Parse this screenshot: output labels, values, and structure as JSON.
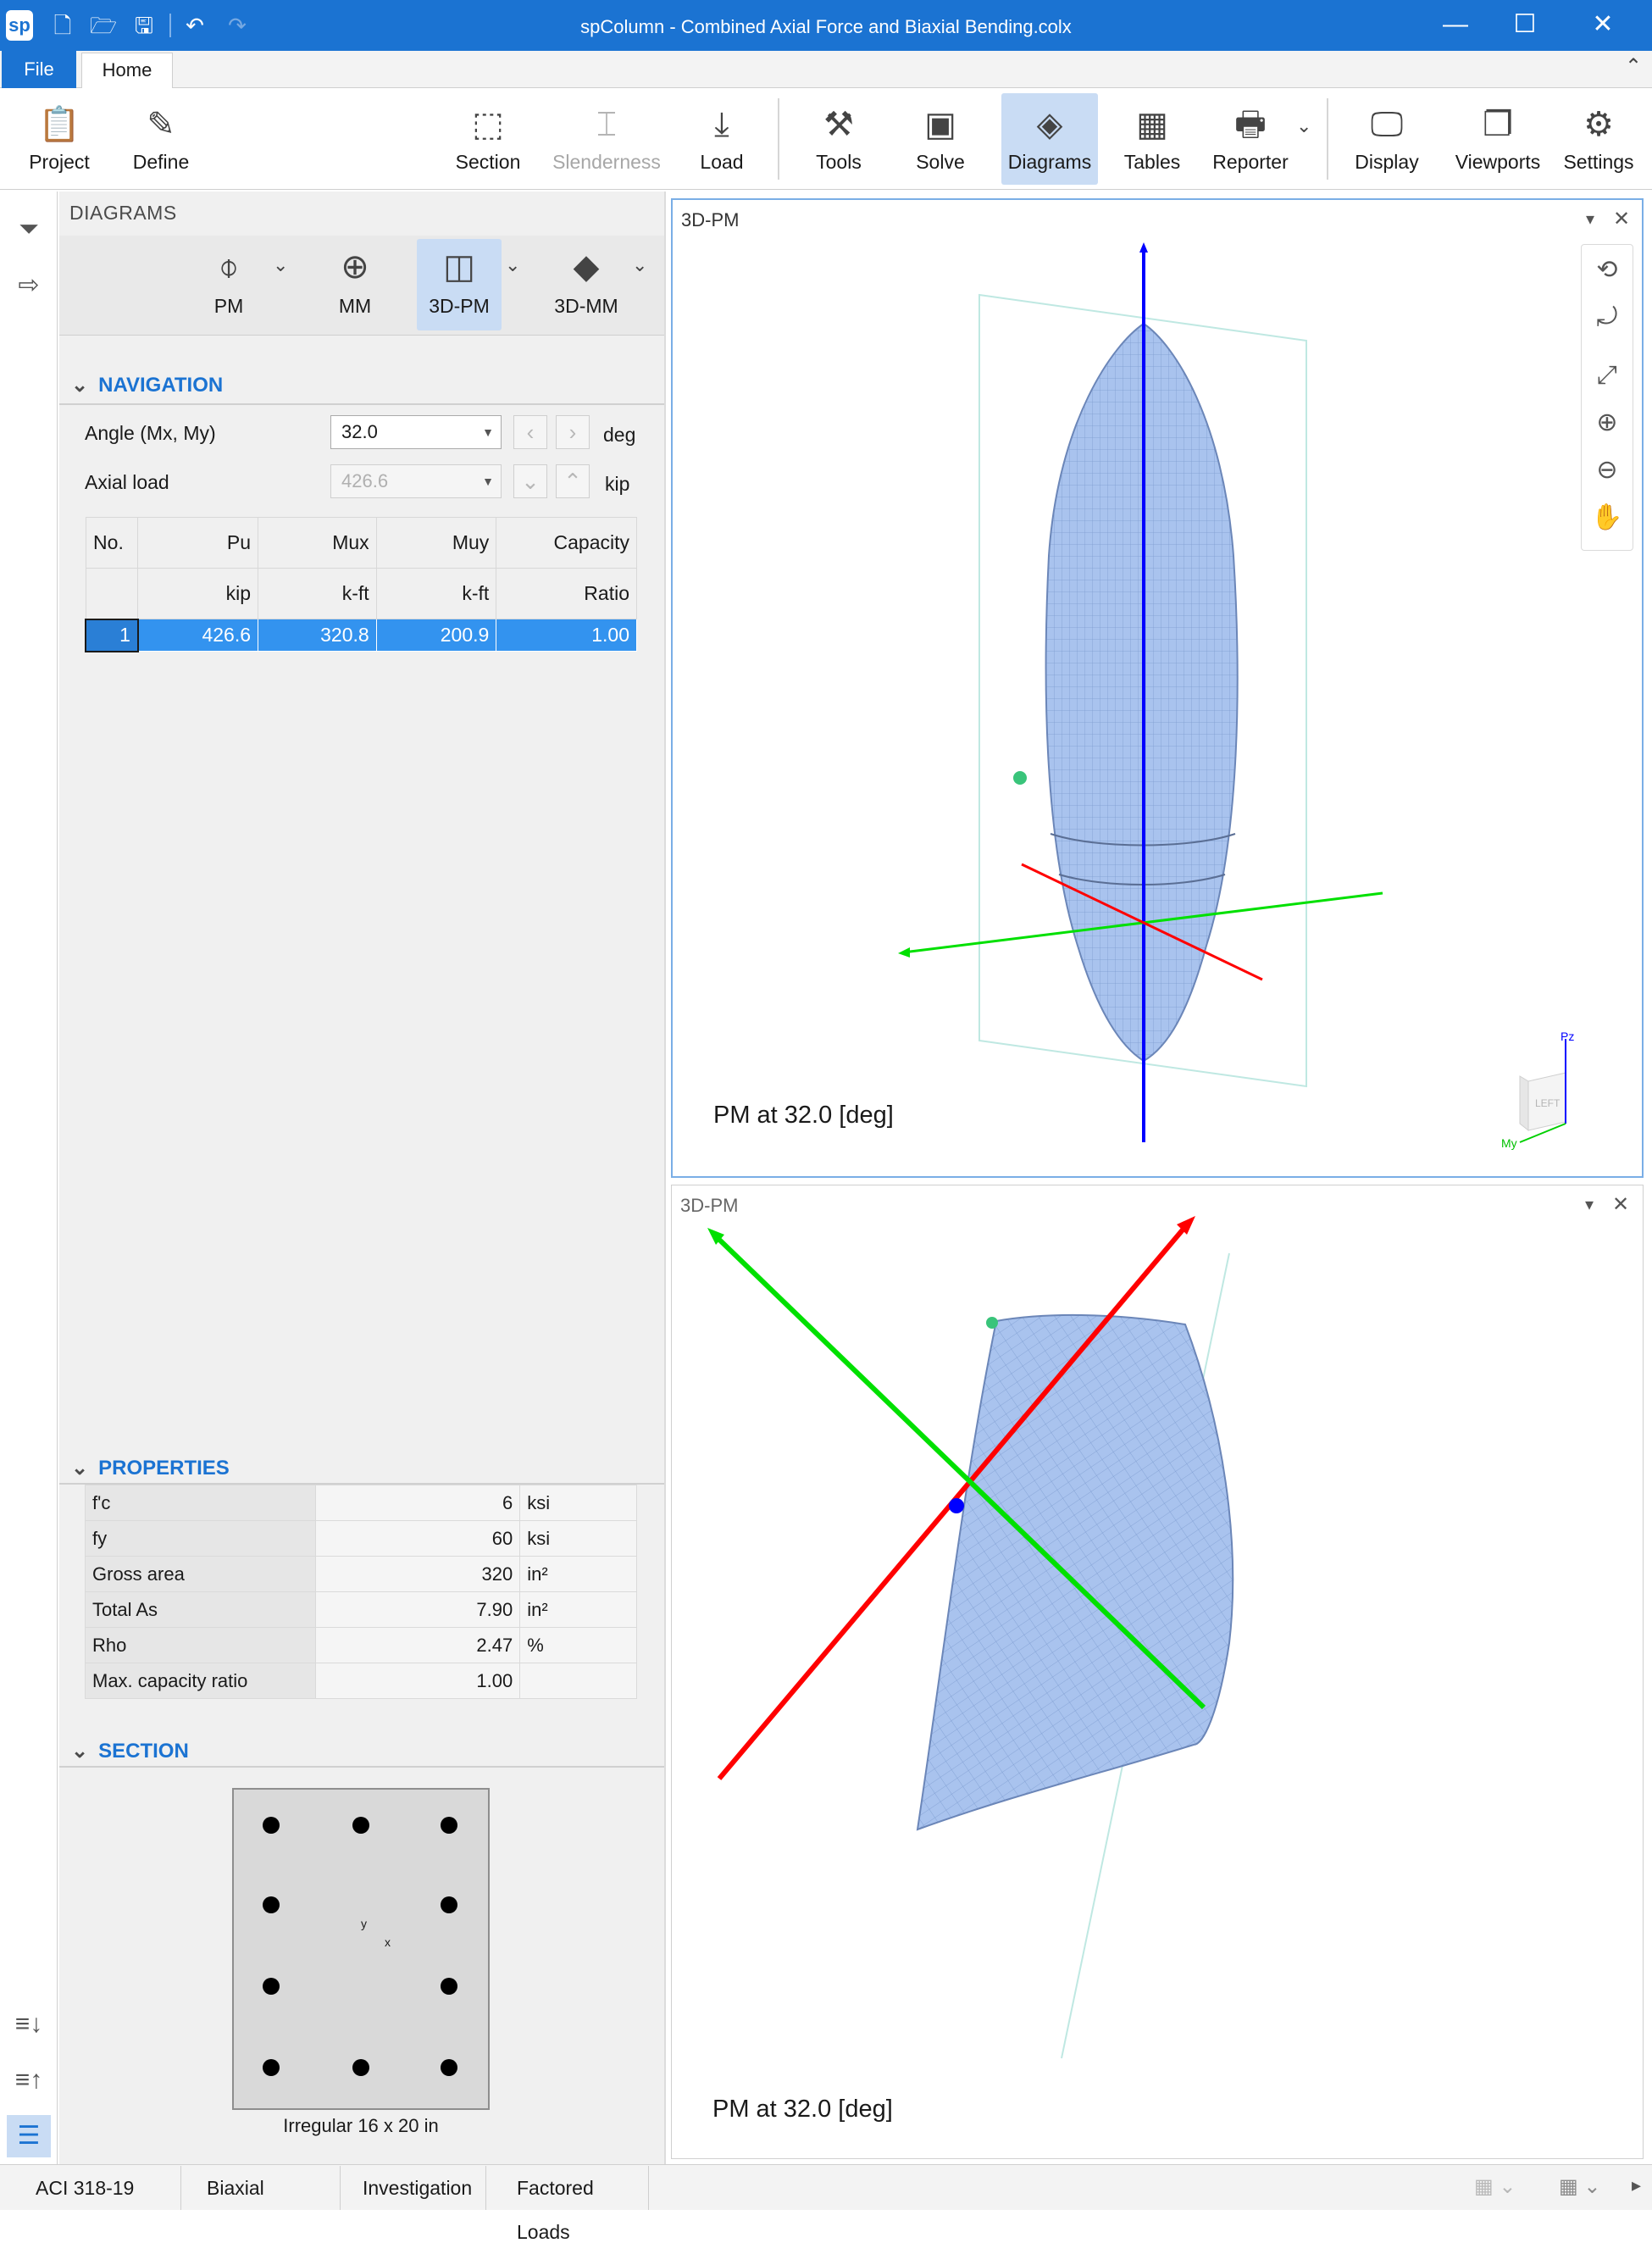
{
  "window": {
    "title": "spColumn - Combined Axial Force and Biaxial Bending.colx",
    "logo": "sp",
    "quick_access": [
      "new-icon",
      "open-icon",
      "save-icon",
      "undo-icon",
      "redo-icon"
    ]
  },
  "tabs": {
    "file": "File",
    "home": "Home"
  },
  "ribbon": {
    "project": "Project",
    "define": "Define",
    "section": "Section",
    "slenderness": "Slenderness",
    "load": "Load",
    "tools": "Tools",
    "solve": "Solve",
    "diagrams": "Diagrams",
    "tables": "Tables",
    "reporter": "Reporter",
    "display": "Display",
    "viewports": "Viewports",
    "settings": "Settings"
  },
  "panel": {
    "title": "DIAGRAMS",
    "diagram_types": {
      "pm": "PM",
      "mm": "MM",
      "pm3d": "3D-PM",
      "mm3d": "3D-MM"
    },
    "navigation": {
      "header": "NAVIGATION",
      "angle_label": "Angle (Mx, My)",
      "angle_value": "32.0",
      "angle_unit": "deg",
      "axial_label": "Axial load",
      "axial_value": "426.6",
      "axial_unit": "kip",
      "table": {
        "headers": [
          "No.",
          "Pu",
          "Mux",
          "Muy",
          "Capacity"
        ],
        "units": [
          "",
          "kip",
          "k-ft",
          "k-ft",
          "Ratio"
        ],
        "rows": [
          [
            "1",
            "426.6",
            "320.8",
            "200.9",
            "1.00"
          ]
        ]
      }
    },
    "properties": {
      "header": "PROPERTIES",
      "rows": [
        {
          "name": "f'c",
          "value": "6",
          "unit": "ksi"
        },
        {
          "name": "fy",
          "value": "60",
          "unit": "ksi"
        },
        {
          "name": "Gross area",
          "value": "320",
          "unit": "in²"
        },
        {
          "name": "Total As",
          "value": "7.90",
          "unit": "in²"
        },
        {
          "name": "Rho",
          "value": "2.47",
          "unit": "%"
        },
        {
          "name": "Max. capacity ratio",
          "value": "1.00",
          "unit": ""
        }
      ]
    },
    "section": {
      "header": "SECTION",
      "caption": "Irregular 16 x 20 in",
      "axis_y": "y",
      "axis_x": "x"
    }
  },
  "viewports": [
    {
      "title": "3D-PM",
      "caption": "PM at 32.0 [deg]",
      "cube_label": "LEFT",
      "axis_pz": "Pz",
      "axis_my": "My"
    },
    {
      "title": "3D-PM",
      "caption": "PM at 32.0 [deg]"
    }
  ],
  "statusbar": [
    "ACI 318-19",
    "Biaxial",
    "Investigation",
    "Factored Loads"
  ],
  "colors": {
    "accent": "#1b73d2",
    "selection": "#3393ef",
    "surface": "#a9c3ee",
    "axis_x": "#ff0000",
    "axis_y": "#00e000",
    "axis_z": "#0000ff"
  }
}
